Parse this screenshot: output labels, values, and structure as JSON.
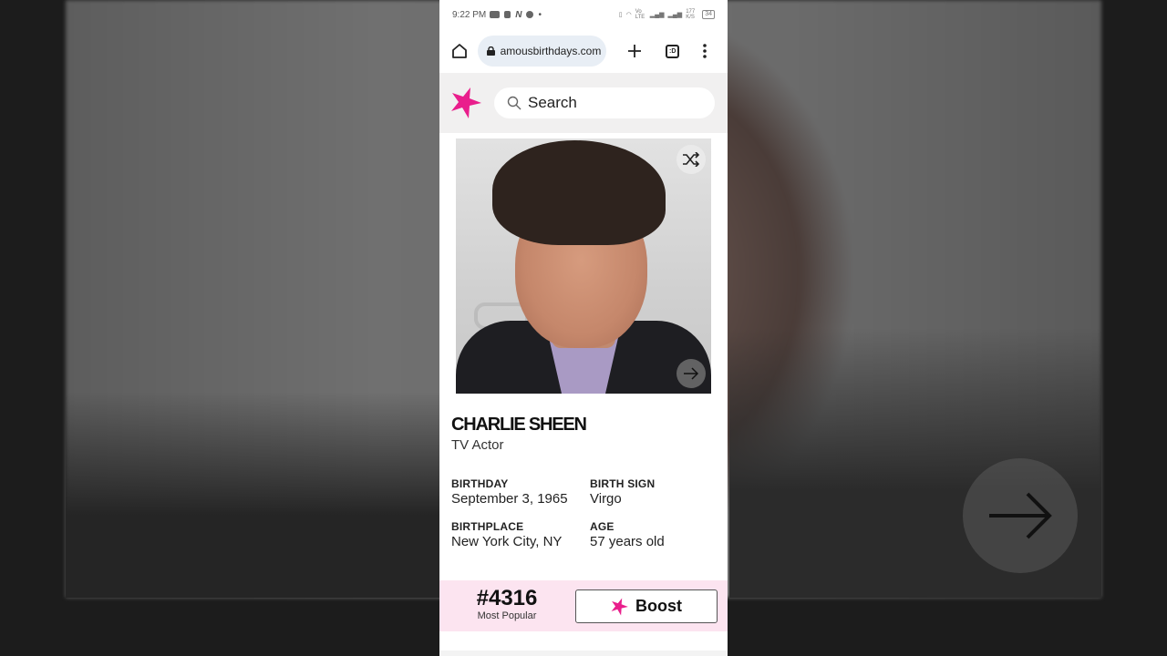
{
  "background": {
    "next_icon": "arrow-right-icon"
  },
  "statusbar": {
    "time": "9:22 PM",
    "network_speed": "177 K/S",
    "network_type": "Vo LTE",
    "battery": "34"
  },
  "browser": {
    "url": "amousbirthdays.com",
    "tab_icon_label": ":D"
  },
  "site": {
    "brand_color": "#e91e8c",
    "search_placeholder": "Search"
  },
  "profile": {
    "name": "CHARLIE SHEEN",
    "profession": "TV Actor",
    "facts": [
      {
        "label": "BIRTHDAY",
        "value": "September 3, 1965"
      },
      {
        "label": "BIRTH SIGN",
        "value": "Virgo"
      },
      {
        "label": "BIRTHPLACE",
        "value": "New York City, NY"
      },
      {
        "label": "AGE",
        "value": "57 years old"
      }
    ]
  },
  "ranking": {
    "rank": "#4316",
    "rank_label": "Most Popular",
    "boost_label": "Boost"
  }
}
